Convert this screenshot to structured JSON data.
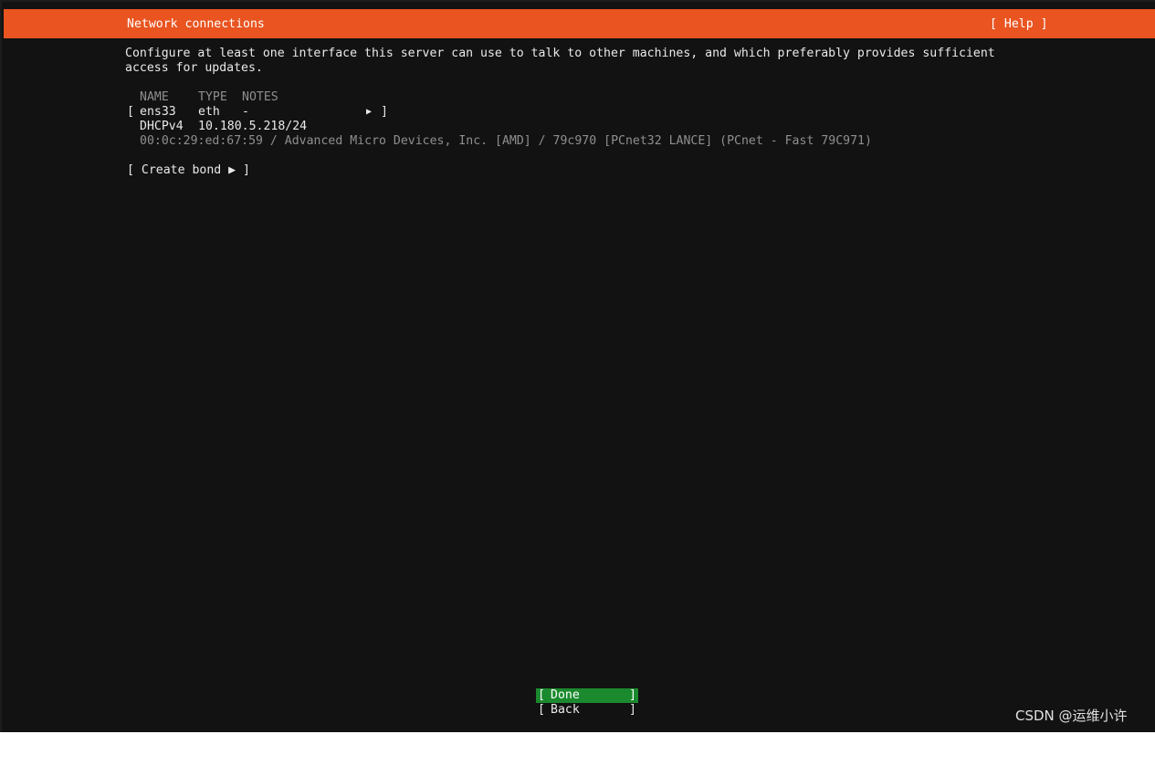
{
  "header": {
    "title": "Network connections",
    "help_label": "[ Help ]"
  },
  "description": {
    "line1": "Configure at least one interface this server can use to talk to other machines, and which preferably provides sufficient",
    "line2": "access for updates."
  },
  "table": {
    "columns": {
      "name": "NAME",
      "type": "TYPE",
      "notes": "NOTES"
    },
    "interfaces": [
      {
        "open_bracket": "[",
        "name": "ens33",
        "type": "eth",
        "notes": "-",
        "arrow": "▶",
        "close_bracket": "]",
        "address_method": "DHCPv4",
        "address": "10.180.5.218/24",
        "hardware": "00:0c:29:ed:67:59 / Advanced Micro Devices, Inc. [AMD] / 79c970 [PCnet32 LANCE] (PCnet - Fast 79C971)"
      }
    ]
  },
  "create_bond": {
    "label": "[ Create bond ▶ ]"
  },
  "footer": {
    "done_label": "Done",
    "back_label": "Back",
    "open_bracket": "[",
    "close_bracket": "]"
  },
  "watermark": {
    "text": "CSDN @运维小许"
  },
  "colors": {
    "accent": "#e95420",
    "background": "#121212",
    "done_button": "#1b8a2e",
    "dim_text": "#8f8f8f",
    "text": "#e9e9e9"
  }
}
